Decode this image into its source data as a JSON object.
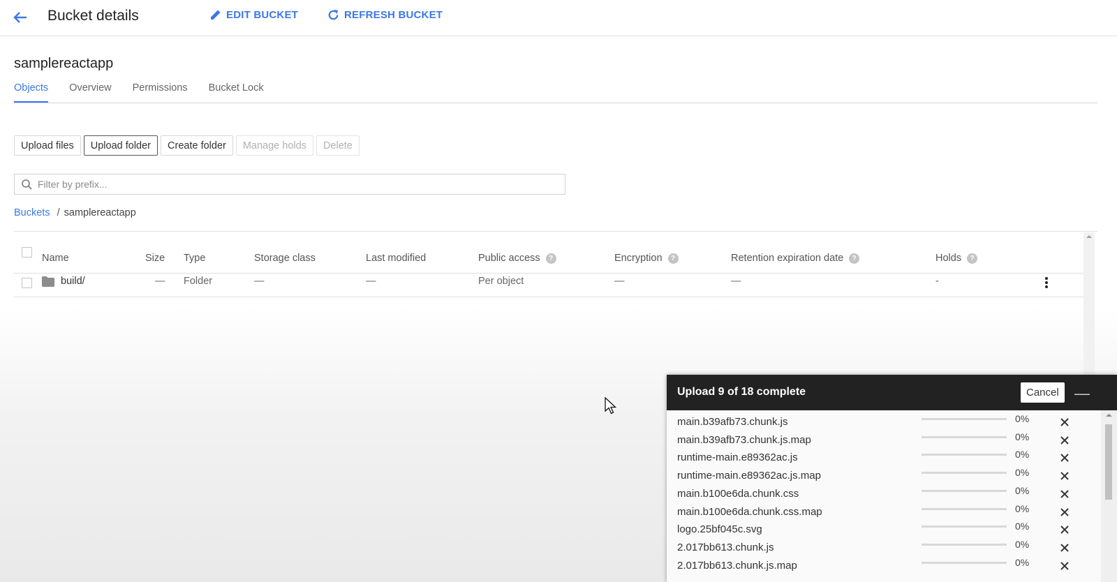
{
  "header": {
    "title": "Bucket details",
    "edit_label": "EDIT BUCKET",
    "refresh_label": "REFRESH BUCKET"
  },
  "bucket": {
    "name": "samplereactapp"
  },
  "tabs": [
    {
      "label": "Objects",
      "active": true
    },
    {
      "label": "Overview",
      "active": false
    },
    {
      "label": "Permissions",
      "active": false
    },
    {
      "label": "Bucket Lock",
      "active": false
    }
  ],
  "toolbar": {
    "upload_files": "Upload files",
    "upload_folder": "Upload folder",
    "create_folder": "Create folder",
    "manage_holds": "Manage holds",
    "delete": "Delete"
  },
  "filter": {
    "placeholder": "Filter by prefix..."
  },
  "breadcrumb": {
    "root": "Buckets",
    "separator": "/",
    "current": "samplereactapp"
  },
  "table": {
    "headers": {
      "name": "Name",
      "size": "Size",
      "type": "Type",
      "storage_class": "Storage class",
      "last_modified": "Last modified",
      "public_access": "Public access",
      "encryption": "Encryption",
      "retention": "Retention expiration date",
      "holds": "Holds"
    },
    "rows": [
      {
        "name": "build/",
        "size": "—",
        "type": "Folder",
        "storage_class": "—",
        "last_modified": "—",
        "public_access": "Per object",
        "encryption": "—",
        "retention": "—",
        "holds": "-"
      }
    ]
  },
  "upload": {
    "title": "Upload 9 of 18 complete",
    "cancel_label": "Cancel",
    "minimize_label": "—",
    "items": [
      {
        "name": "main.b39afb73.chunk.js",
        "percent": "0%",
        "progress": 0
      },
      {
        "name": "main.b39afb73.chunk.js.map",
        "percent": "0%",
        "progress": 0
      },
      {
        "name": "runtime-main.e89362ac.js",
        "percent": "0%",
        "progress": 0
      },
      {
        "name": "runtime-main.e89362ac.js.map",
        "percent": "0%",
        "progress": 0
      },
      {
        "name": "main.b100e6da.chunk.css",
        "percent": "0%",
        "progress": 0
      },
      {
        "name": "main.b100e6da.chunk.css.map",
        "percent": "0%",
        "progress": 0
      },
      {
        "name": "logo.25bf045c.svg",
        "percent": "0%",
        "progress": 0
      },
      {
        "name": "2.017bb613.chunk.js",
        "percent": "0%",
        "progress": 0
      },
      {
        "name": "2.017bb613.chunk.js.map",
        "percent": "0%",
        "progress": 0
      }
    ]
  },
  "colors": {
    "accent": "#3b78e7",
    "panel_header": "#222222"
  }
}
